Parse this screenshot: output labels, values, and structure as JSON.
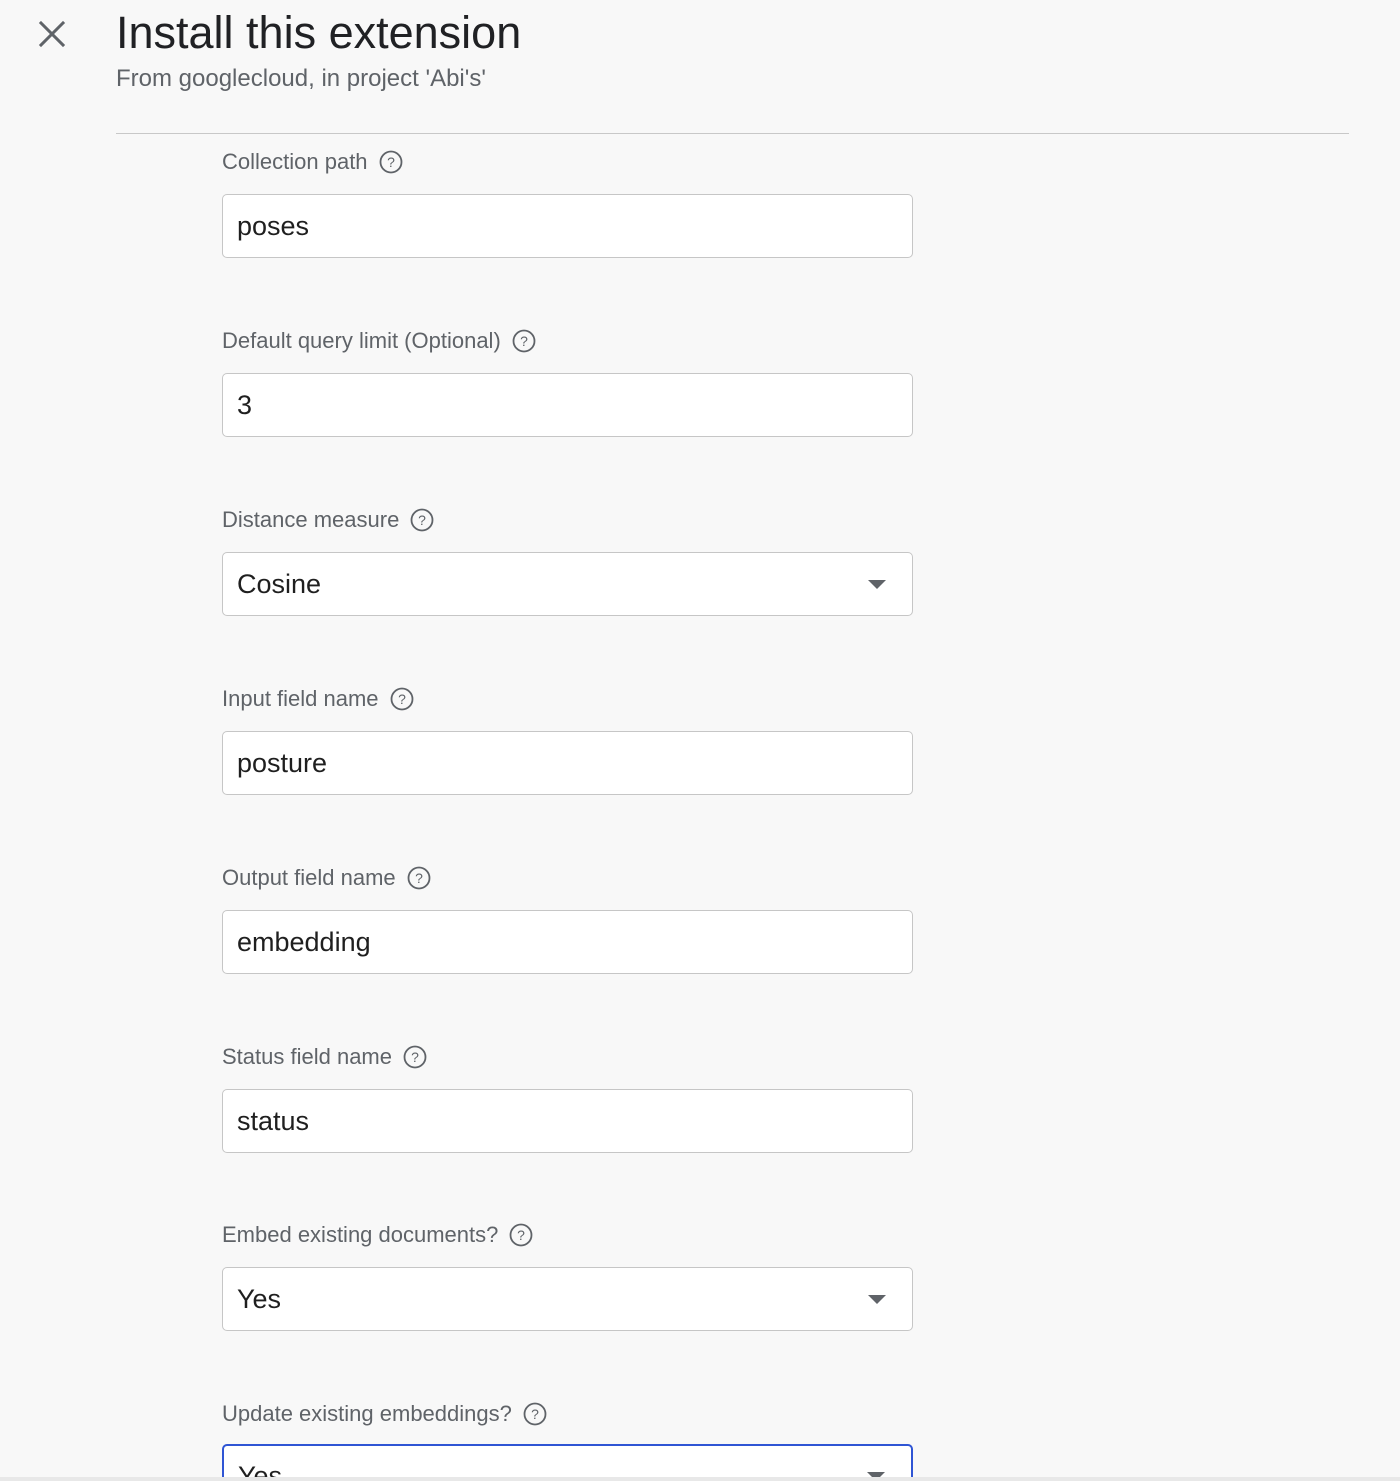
{
  "header": {
    "title": "Install this extension",
    "subtitle": "From googlecloud, in project 'Abi's'"
  },
  "icons": {
    "close": "close-icon",
    "help": "help-circle-icon",
    "dropdown": "dropdown-arrow-icon"
  },
  "fields": [
    {
      "label": "Collection path",
      "value": "poses",
      "type": "text"
    },
    {
      "label": "Default query limit (Optional)",
      "value": "3",
      "type": "text"
    },
    {
      "label": "Distance measure",
      "value": "Cosine",
      "type": "select"
    },
    {
      "label": "Input field name",
      "value": "posture",
      "type": "text"
    },
    {
      "label": "Output field name",
      "value": "embedding",
      "type": "text"
    },
    {
      "label": "Status field name",
      "value": "status",
      "type": "text"
    },
    {
      "label": "Embed existing documents?",
      "value": "Yes",
      "type": "select"
    },
    {
      "label": "Update existing embeddings?",
      "value": "Yes",
      "type": "select",
      "focused": true
    }
  ],
  "colors": {
    "focus_border": "#2f55d4",
    "label": "#5f6368",
    "background": "#f8f8f8"
  }
}
